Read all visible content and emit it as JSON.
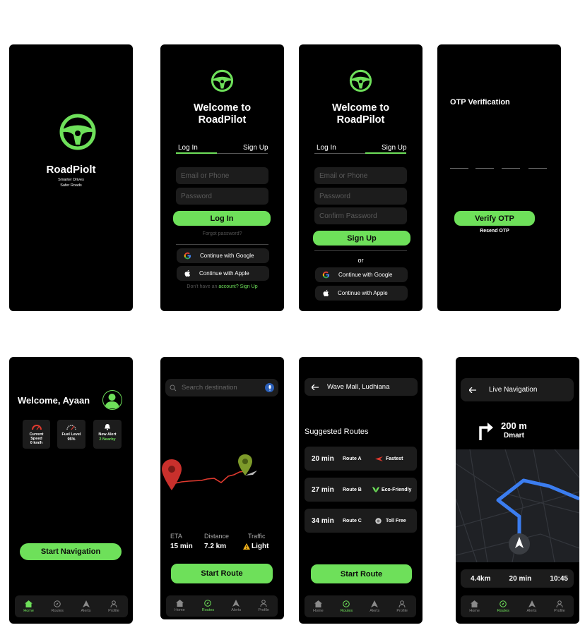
{
  "colors": {
    "accent": "#6ee05a",
    "background": "#000000",
    "surface": "#1c1c1c",
    "route_line": "#3b7df0"
  },
  "splash": {
    "app_name": "RoadPiolt",
    "tagline_1": "Smarter Drives",
    "tagline_2": "Safer Roads"
  },
  "login": {
    "welcome_1": "Welcome to",
    "welcome_2": "RoadPilot",
    "tab_login": "Log In",
    "tab_signup": "Sign Up",
    "email_placeholder": "Email or Phone",
    "password_placeholder": "Password",
    "login_button": "Log In",
    "forgot": "Forgot password?",
    "google": "Continue with Google",
    "apple": "Continue with Apple",
    "no_account": "Don't have an ",
    "signup_link": "account? Sign Up"
  },
  "signup": {
    "welcome_1": "Welcome to",
    "welcome_2": "RoadPilot",
    "tab_login": "Log In",
    "tab_signup": "Sign Up",
    "email_placeholder": "Email or Phone",
    "password_placeholder": "Password",
    "confirm_placeholder": "Confirm Password",
    "signup_button": "Sign Up",
    "or": "or",
    "google": "Continue with Google",
    "apple": "Continue with Apple"
  },
  "otp": {
    "title": "OTP Verification",
    "verify_button": "Verify OTP",
    "resend": "Resend OTP"
  },
  "home": {
    "welcome": "Welcome, Ayaan",
    "cards": [
      {
        "label": "Current Speed",
        "value": "0 km/h",
        "icon": "speedometer-icon"
      },
      {
        "label": "Fuel Level",
        "value": "95%",
        "icon": "gauge-icon"
      },
      {
        "label": "New Alert",
        "value": "2 Nearby",
        "icon": "bell-icon"
      }
    ],
    "start_button": "Start Navigation"
  },
  "tabbar": {
    "home": "Home",
    "routes": "Routes",
    "alerts": "Alerts",
    "profile": "Profile"
  },
  "map": {
    "search_placeholder": "Search destination",
    "eta_label": "ETA",
    "eta_value": "15 min",
    "distance_label": "Distance",
    "distance_value": "7.2 km",
    "traffic_label": "Traffic",
    "traffic_value": "Light",
    "start_button": "Start Route"
  },
  "routes": {
    "destination": "Wave Mall, Ludhiana",
    "heading": "Suggested Routes",
    "items": [
      {
        "time": "20 min",
        "name": "Route A",
        "tag": "Fastest"
      },
      {
        "time": "27 min",
        "name": "Route B",
        "tag": "Eco-Friendly"
      },
      {
        "time": "34 min",
        "name": "Route C",
        "tag": "Toll Free"
      }
    ],
    "start_button": "Start Route"
  },
  "live": {
    "title": "Live Navigation",
    "distance": "200 m",
    "street": "Dmart",
    "total_distance": "4.4km",
    "time": "20 min",
    "arrival": "10:45"
  }
}
